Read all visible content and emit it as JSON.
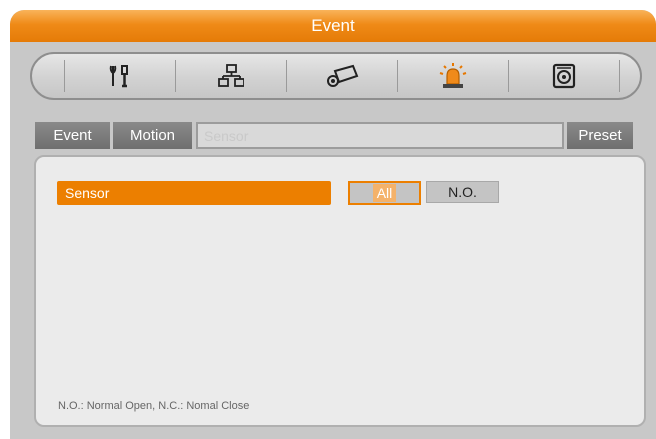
{
  "window": {
    "title": "Event"
  },
  "toolbar": {
    "icons": [
      "tools-icon",
      "network-icon",
      "camera-icon",
      "alarm-icon",
      "disk-icon"
    ],
    "active_index": 3
  },
  "tabs": {
    "event": "Event",
    "motion": "Motion",
    "sensor": "Sensor",
    "preset": "Preset"
  },
  "panel": {
    "sensor_label": "Sensor",
    "all_button": "All",
    "no_button": "N.O.",
    "footnote": "N.O.: Normal Open,  N.C.: Nomal Close"
  },
  "colors": {
    "accent": "#ec7f00",
    "title_bar": "#ef8a17",
    "active_icon": "#e67700"
  }
}
